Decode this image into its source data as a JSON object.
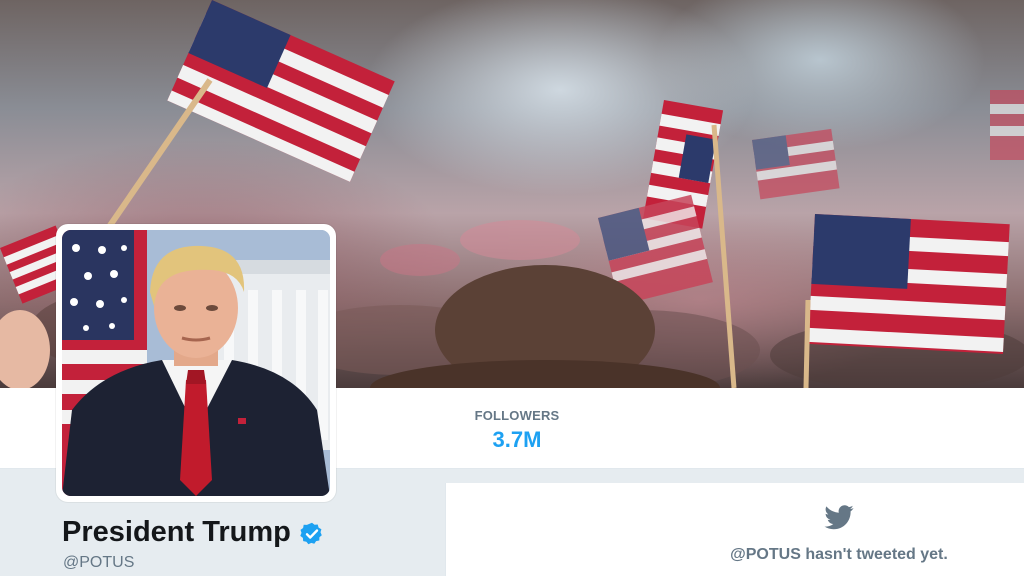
{
  "stats": {
    "followers_label": "FOLLOWERS",
    "followers_value": "3.7M"
  },
  "profile": {
    "name": "President Trump",
    "handle": "@POTUS",
    "verified": true
  },
  "timeline": {
    "empty_message": "@POTUS hasn't tweeted yet."
  },
  "icons": {
    "verified": "verified-badge-icon",
    "empty_state": "twitter-bird-icon"
  },
  "colors": {
    "accent": "#1da1f2",
    "secondary_text": "#657786",
    "background": "#e6ecf0",
    "name_text": "#14171a"
  }
}
